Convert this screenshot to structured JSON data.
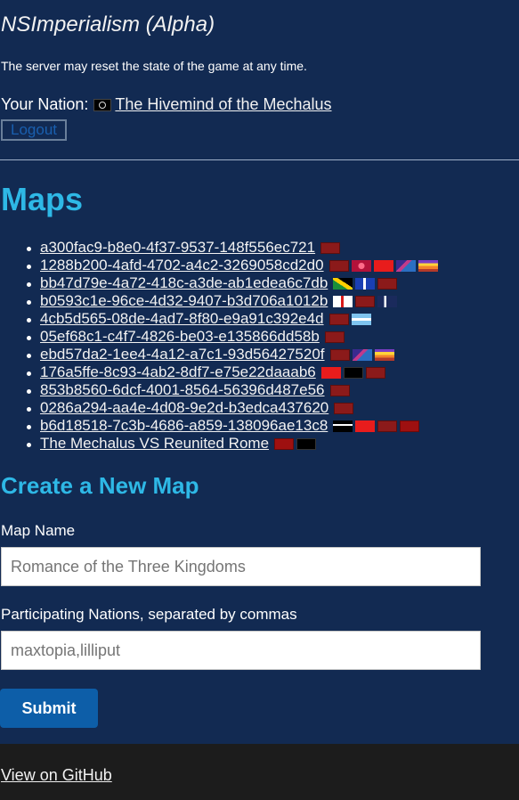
{
  "header": {
    "title": "NSImperialism (Alpha)",
    "reset_note": "The server may reset the state of the game at any time."
  },
  "user": {
    "nation_label": "Your Nation:",
    "nation_name": "The Hivemind of the Mechalus",
    "logout_label": "Logout"
  },
  "maps": {
    "heading": "Maps",
    "items": [
      {
        "id": "a300fac9-b8e0-4f37-9537-148f556ec721",
        "flags": [
          "red-emblem-flag"
        ]
      },
      {
        "id": "1288b200-4afd-4702-a4c2-3269058cd2d0",
        "flags": [
          "red-emblem-flag",
          "crimson-seal-flag",
          "red-star-flag",
          "purple-blue-flag",
          "orange-stripes-flag"
        ]
      },
      {
        "id": "bb47d79e-4a72-418c-a3de-ab1edea6c7db",
        "flags": [
          "green-gold-saltire-flag",
          "blue-white-cross-flag",
          "red-emblem-flag"
        ]
      },
      {
        "id": "b0593c1e-96ce-4d32-9407-b3d706a1012b",
        "flags": [
          "red-white-cross-flag",
          "red-emblem-flag",
          "nordic-blue-flag"
        ]
      },
      {
        "id": "4cb5d565-08de-4ad7-8f80-e9a91c392e4d",
        "flags": [
          "red-emblem-flag",
          "light-blue-flag"
        ]
      },
      {
        "id": "05ef68c1-c4f7-4826-be03-e135866dd58b",
        "flags": [
          "red-emblem-flag"
        ]
      },
      {
        "id": "ebd57da2-1ee4-4a12-a7c1-93d56427520f",
        "flags": [
          "red-emblem-flag",
          "purple-blue-flag",
          "orange-stripes-flag"
        ]
      },
      {
        "id": "176a5ffe-8c93-4ab2-8df7-e75e22daaab6",
        "flags": [
          "swiss-cross-flag",
          "black-ring-flag",
          "red-emblem-flag"
        ]
      },
      {
        "id": "853b8560-6dcf-4001-8564-56396d487e56",
        "flags": [
          "red-emblem-flag"
        ]
      },
      {
        "id": "0286a294-aa4e-4d08-9e2d-b3edca437620",
        "flags": [
          "red-emblem-flag"
        ]
      },
      {
        "id": "b6d18518-7c3b-4686-a859-138096ae13c8",
        "flags": [
          "black-white-stripes-flag",
          "red-star-flag",
          "red-emblem-flag",
          "dark-red-emblem-flag"
        ]
      },
      {
        "id": "The Mechalus VS Reunited Rome",
        "flags": [
          "dark-red-emblem-flag",
          "black-ring-flag"
        ]
      }
    ]
  },
  "create": {
    "heading": "Create a New Map",
    "name_label": "Map Name",
    "name_placeholder": "Romance of the Three Kingdoms",
    "nations_label": "Participating Nations, separated by commas",
    "nations_placeholder": "maxtopia,lilliput",
    "submit_label": "Submit"
  },
  "footer": {
    "github_label": "View on GitHub"
  },
  "colors": {
    "background": "#122a52",
    "heading_accent": "#2eb8e6",
    "button_primary": "#0d5ea8",
    "footer_background": "#1c1c1c"
  }
}
